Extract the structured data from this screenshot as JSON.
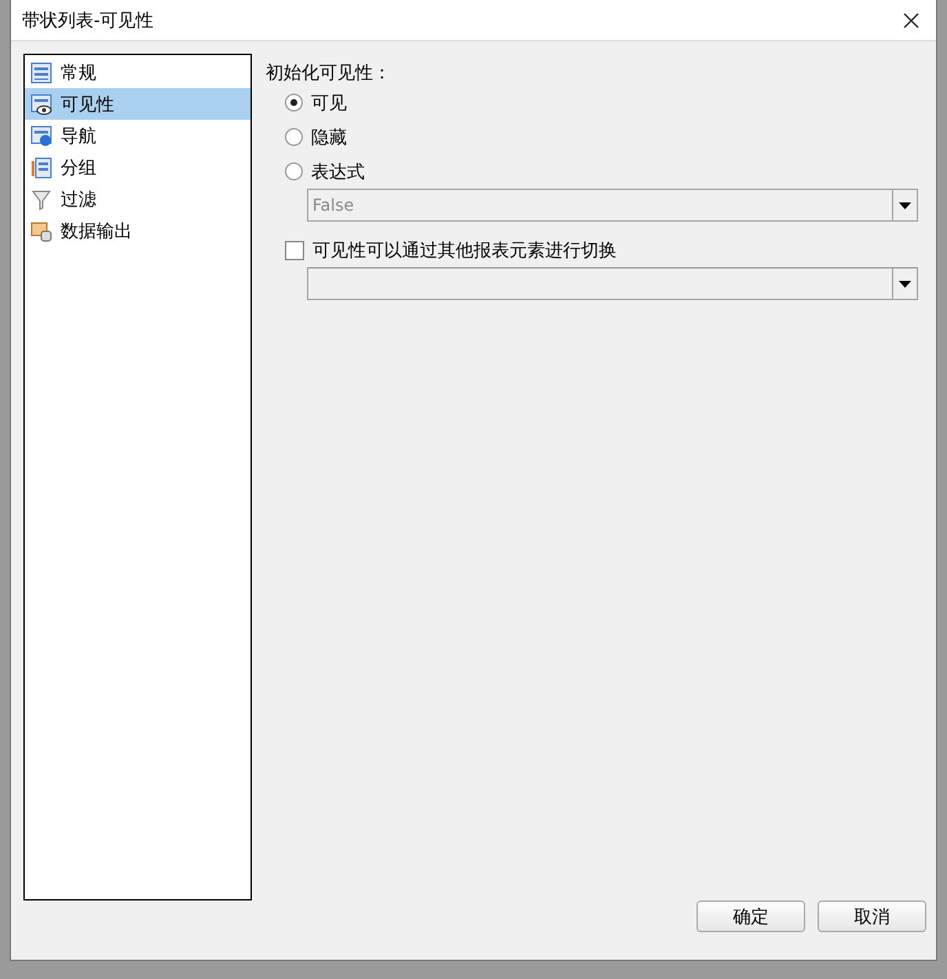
{
  "window": {
    "title": "带状列表-可见性"
  },
  "sidebar": {
    "items": [
      {
        "label": "常规",
        "selected": false
      },
      {
        "label": "可见性",
        "selected": true
      },
      {
        "label": "导航",
        "selected": false
      },
      {
        "label": "分组",
        "selected": false
      },
      {
        "label": "过滤",
        "selected": false
      },
      {
        "label": "数据输出",
        "selected": false
      }
    ]
  },
  "visibility": {
    "heading": "初始化可见性：",
    "options": [
      {
        "label": "可见",
        "selected": true
      },
      {
        "label": "隐藏",
        "selected": false
      },
      {
        "label": "表达式",
        "selected": false
      }
    ],
    "expression": {
      "value": "False",
      "disabled": true
    },
    "toggle": {
      "label": "可见性可以通过其他报表元素进行切换",
      "checked": false
    }
  },
  "buttons": [
    "确定",
    "取消"
  ]
}
